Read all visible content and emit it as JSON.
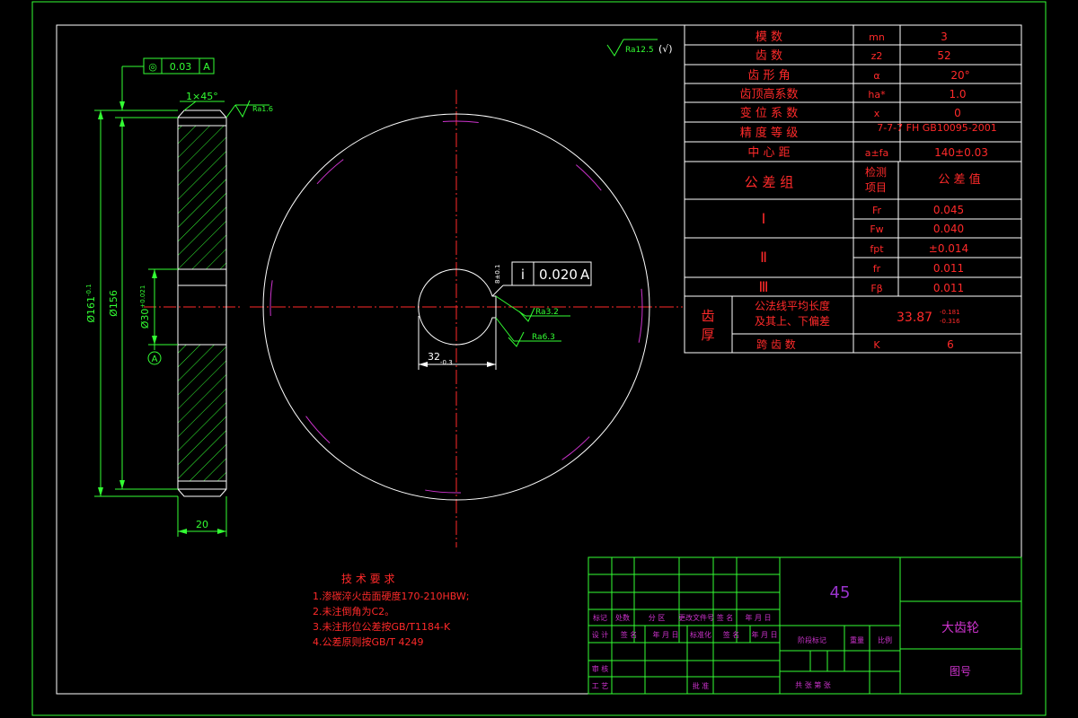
{
  "note": {
    "title": "技 术 要 求",
    "items": [
      "1.渗碳淬火齿面硬度170-210HBW;",
      "2.未注倒角为C2。",
      "3.未注形位公差按GB/T1184-K",
      "4.公差原则按GB/T 4249"
    ]
  },
  "gear_table": {
    "rows": [
      {
        "name": "模    数",
        "sym": "mn",
        "val": "3"
      },
      {
        "name": "齿    数",
        "sym": "z2",
        "val": "52"
      },
      {
        "name": "齿 形 角",
        "sym": "α",
        "val": "20°"
      },
      {
        "name": "齿顶高系数",
        "sym": "ha*",
        "val": "1.0"
      },
      {
        "name": "变 位 系 数",
        "sym": "x",
        "val": "0"
      },
      {
        "name": "精 度 等 级",
        "sym": "",
        "val": "7-7-7 FH GB10095-2001"
      },
      {
        "name": "中 心 距",
        "sym": "a±fa",
        "val": "140±0.03"
      }
    ],
    "tol_header": {
      "group": "公  差  组",
      "item": "检测\n项目",
      "value": "公 差 值"
    },
    "tol_groups": [
      {
        "group": "Ⅰ",
        "rows": [
          {
            "sym": "Fr",
            "val": "0.045"
          },
          {
            "sym": "Fw",
            "val": "0.040"
          }
        ]
      },
      {
        "group": "Ⅱ",
        "rows": [
          {
            "sym": "fpt",
            "val": "±0.014"
          },
          {
            "sym": "fr",
            "val": "0.011"
          }
        ]
      },
      {
        "group": "Ⅲ",
        "rows": [
          {
            "sym": "Fβ",
            "val": "0.011"
          }
        ]
      }
    ],
    "thickness": {
      "label": "齿\n厚",
      "line1": "公法线平均长度",
      "line2": "及其上、下偏差",
      "value": "33.87",
      "upper": "-0.181",
      "lower": "-0.316",
      "span_label": "跨 齿 数",
      "span_sym": "K",
      "span_val": "6"
    }
  },
  "title_block": {
    "material": "45",
    "part_name": "大齿轮",
    "drawing_no": "图号",
    "row_labels": [
      "标记",
      "处数",
      "分 区",
      "更改文件号",
      "签 名",
      "年 月 日"
    ],
    "design_row": [
      "设 计",
      "签 名",
      "年 月 日",
      "标准化",
      "签 名",
      "年 月 日"
    ],
    "stage": [
      "阶段标记",
      "重量",
      "比例"
    ],
    "review": "审 核",
    "process": "工 艺",
    "approve": "批 准",
    "sheets": "共 张 第 张"
  },
  "dimensions": {
    "od": "Ø161",
    "od_tol": "-0.1",
    "pitch": "Ø156",
    "bore": "Ø30",
    "bore_tol": "+0.021",
    "chamfer": "1×45°",
    "width": "20",
    "keyway": "32",
    "keyway_tol": "-0.3",
    "runout_sym": "◎",
    "runout_val": "0.03",
    "runout_ref": "A",
    "datum": "A",
    "sym_sym": "i",
    "sym_val": "0.020",
    "sym_ref": "A",
    "ra_general": "Ra12.5",
    "ra_general_note": "(√)",
    "ra_face": "Ra1.6",
    "ra_key1": "Ra3.2",
    "ra_key2": "Ra6.3",
    "key_depth": "8±0.1"
  }
}
